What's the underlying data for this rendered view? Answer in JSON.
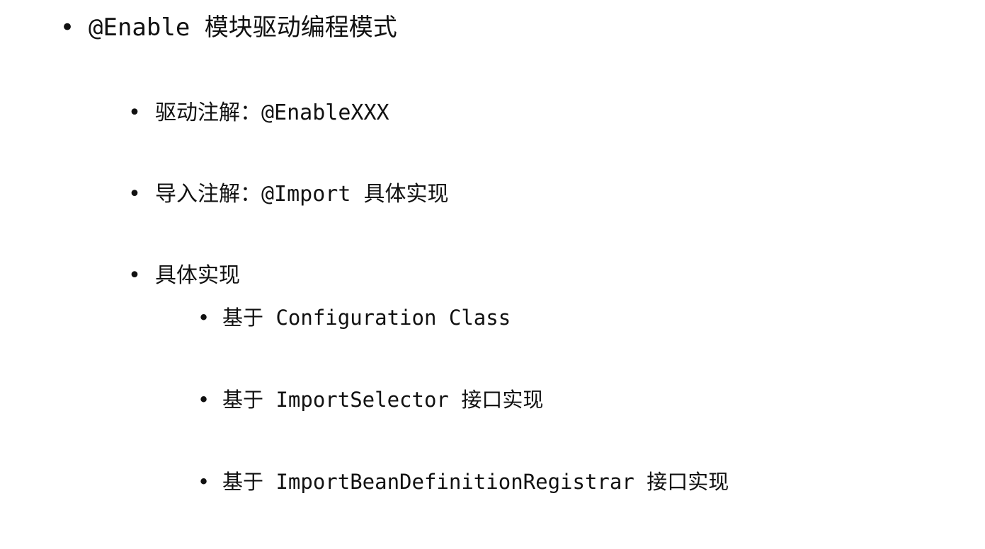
{
  "items": [
    {
      "bullet": "•",
      "text": "@Enable 模块驱动编程模式"
    },
    {
      "bullet": "•",
      "text": "驱动注解：@EnableXXX"
    },
    {
      "bullet": "•",
      "text": "导入注解：@Import 具体实现"
    },
    {
      "bullet": "•",
      "text": "具体实现"
    },
    {
      "bullet": "•",
      "text": "基于 Configuration Class"
    },
    {
      "bullet": "•",
      "text": "基于 ImportSelector 接口实现"
    },
    {
      "bullet": "•",
      "text": "基于 ImportBeanDefinitionRegistrar 接口实现"
    }
  ]
}
